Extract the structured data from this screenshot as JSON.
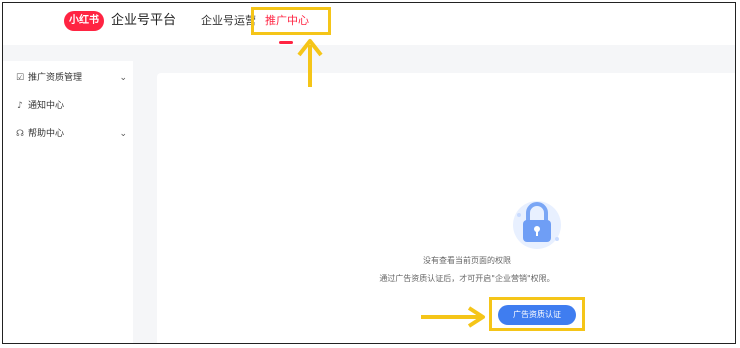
{
  "header": {
    "logo_badge": "小红书",
    "platform_title": "企业号平台",
    "nav": [
      {
        "label": "企业号运营"
      },
      {
        "label": "推广中心"
      }
    ]
  },
  "sidebar": {
    "items": [
      {
        "label": "推广资质管理",
        "icon": "calendar-check-icon",
        "expandable": true
      },
      {
        "label": "通知中心",
        "icon": "bell-icon",
        "expandable": false
      },
      {
        "label": "帮助中心",
        "icon": "headset-icon",
        "expandable": true
      }
    ]
  },
  "main": {
    "no_permission": "没有查看当前页面的权限",
    "hint": "通过广告资质认证后，才可开启\"企业营销\"权限。",
    "cert_button": "广告资质认证"
  },
  "colors": {
    "brand": "#ff2442",
    "primary_button": "#3f7df0",
    "annotation": "#f5c518"
  }
}
